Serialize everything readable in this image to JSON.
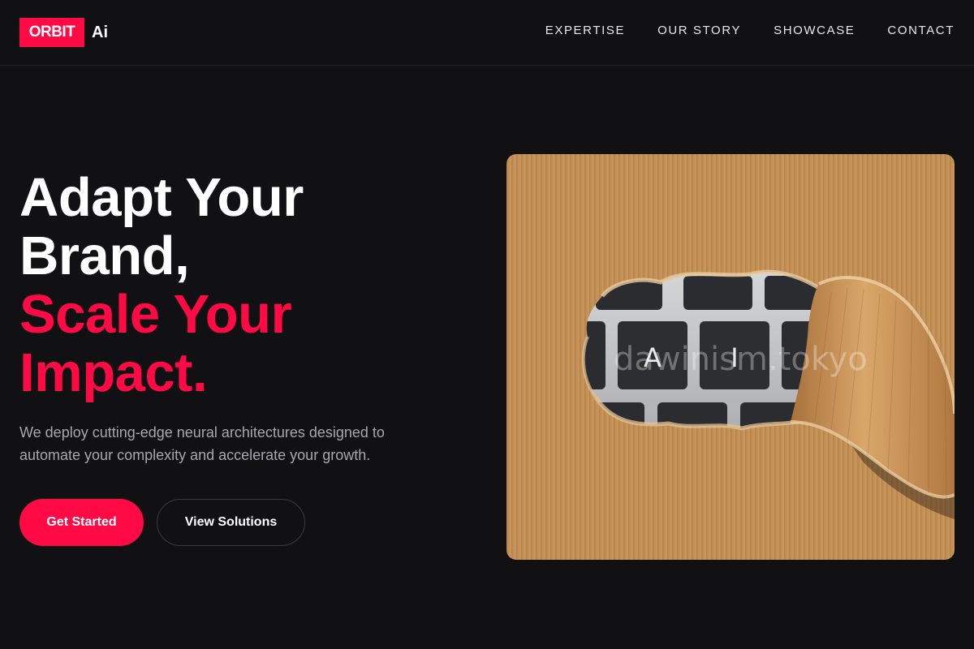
{
  "brand": {
    "name": "ORBIT",
    "suffix": "Ai",
    "accent_color": "#ff0a45"
  },
  "nav": {
    "items": [
      {
        "label": "EXPERTISE"
      },
      {
        "label": "OUR STORY"
      },
      {
        "label": "SHOWCASE"
      },
      {
        "label": "CONTACT"
      }
    ]
  },
  "hero": {
    "title_line1": "Adapt Your",
    "title_line2": "Brand,",
    "title_line3": "Scale Your",
    "title_line4": "Impact.",
    "subtitle_line1": "We deploy cutting-edge neural architectures designed to",
    "subtitle_line2": "automate your complexity and accelerate your growth.",
    "primary_button": "Get Started",
    "secondary_button": "View Solutions"
  },
  "image": {
    "key_left": "A",
    "key_right": "I",
    "watermark": "dawinism.tokyo",
    "icon": "torn-paper-keyboard-photo"
  }
}
